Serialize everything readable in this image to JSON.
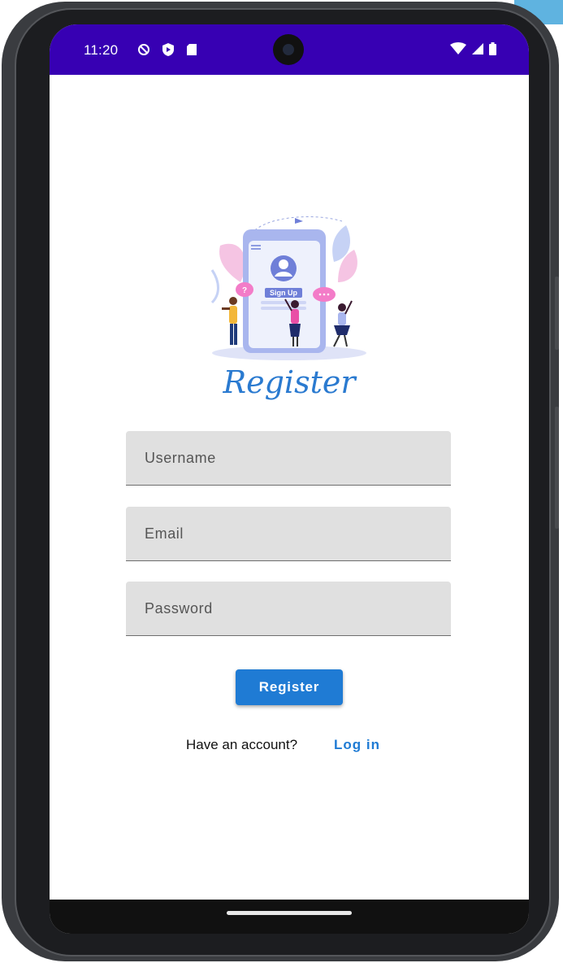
{
  "status_bar": {
    "time": "11:20",
    "icons_left": [
      "vpn-key-icon",
      "play-protect-icon",
      "sd-card-icon"
    ],
    "icons_right": [
      "wifi-icon",
      "cellular-signal-icon",
      "battery-icon"
    ],
    "background_color": "#3700b3"
  },
  "illustration": {
    "sign_up_text": "Sign Up"
  },
  "form": {
    "title": "Register",
    "username_placeholder": "Username",
    "email_placeholder": "Email",
    "password_placeholder": "Password",
    "register_button": "Register",
    "have_account_text": "Have an account?",
    "login_link": "Log in",
    "accent_color": "#1f7bd4"
  }
}
